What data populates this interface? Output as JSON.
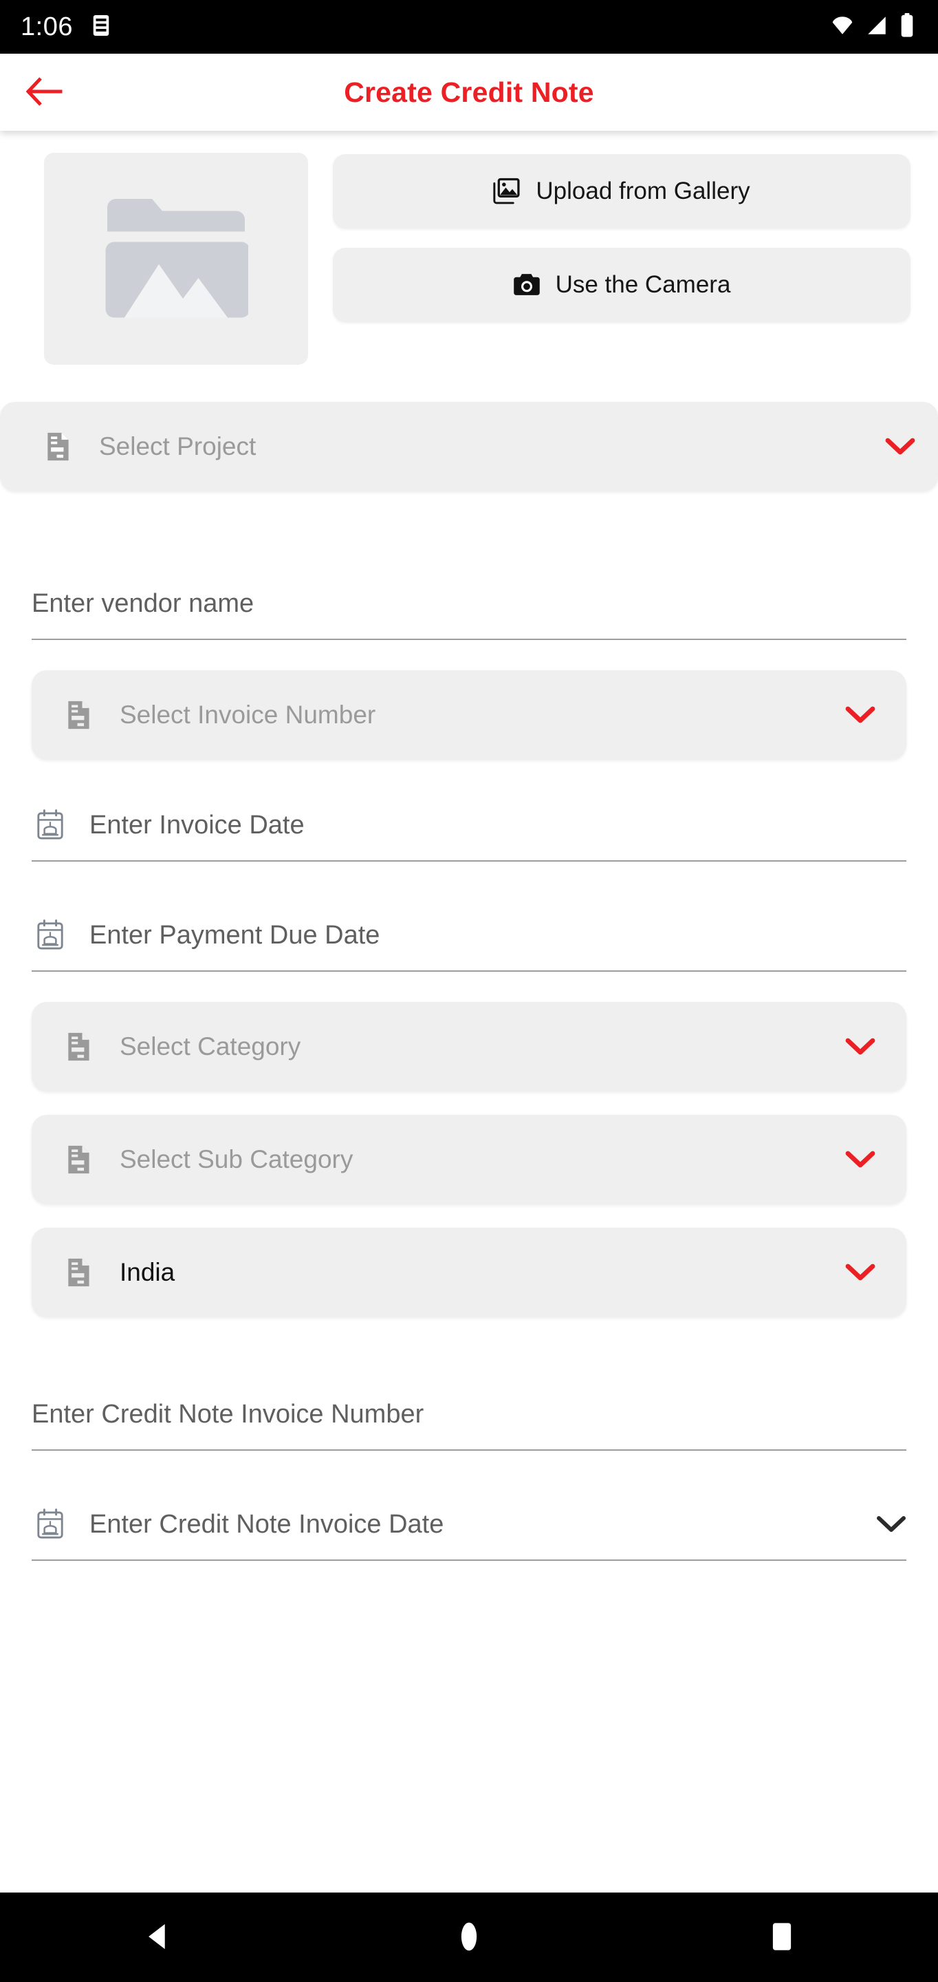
{
  "status_bar": {
    "time": "1:06",
    "notification_icon": "notification-icon",
    "wifi_icon": "wifi-icon",
    "signal_icon": "cellular-signal-icon",
    "battery_icon": "battery-icon"
  },
  "header": {
    "back_icon": "back-arrow-icon",
    "title": "Create Credit Note",
    "accent_color": "#EC2024"
  },
  "upload": {
    "preview_placeholder_icon": "image-placeholder-icon",
    "gallery_button": {
      "label": "Upload from Gallery",
      "icon": "gallery-photos-icon"
    },
    "camera_button": {
      "label": "Use the Camera",
      "icon": "camera-icon"
    }
  },
  "form": {
    "project": {
      "label": "Select Project",
      "icon": "document-icon",
      "chevron": "chevron-down-icon",
      "filled": false
    },
    "vendor_name": {
      "placeholder": "Enter vendor name"
    },
    "invoice_number": {
      "label": "Select Invoice Number",
      "icon": "document-icon",
      "chevron": "chevron-down-icon",
      "filled": false
    },
    "invoice_date": {
      "placeholder": "Enter Invoice Date",
      "icon": "calendar-icon"
    },
    "payment_due_date": {
      "placeholder": "Enter Payment Due Date",
      "icon": "calendar-icon"
    },
    "category": {
      "label": "Select Category",
      "icon": "document-icon",
      "chevron": "chevron-down-icon",
      "filled": false
    },
    "sub_category": {
      "label": "Select Sub Category",
      "icon": "document-icon",
      "chevron": "chevron-down-icon",
      "filled": false
    },
    "country": {
      "label": "India",
      "icon": "document-icon",
      "chevron": "chevron-down-icon",
      "filled": true
    },
    "credit_note_invoice_number": {
      "placeholder": "Enter Credit Note Invoice Number"
    },
    "credit_note_invoice_date": {
      "placeholder": "Enter Credit Note Invoice Date",
      "icon": "calendar-icon",
      "chevron": "chevron-down-icon"
    }
  },
  "nav_bar": {
    "back": "nav-back-icon",
    "home": "nav-home-icon",
    "recents": "nav-recents-icon"
  },
  "colors": {
    "accent_red": "#EC2024",
    "field_bg": "#efefef",
    "placeholder_text": "#9a9a9a",
    "underline_text": "#5f5f5f"
  }
}
